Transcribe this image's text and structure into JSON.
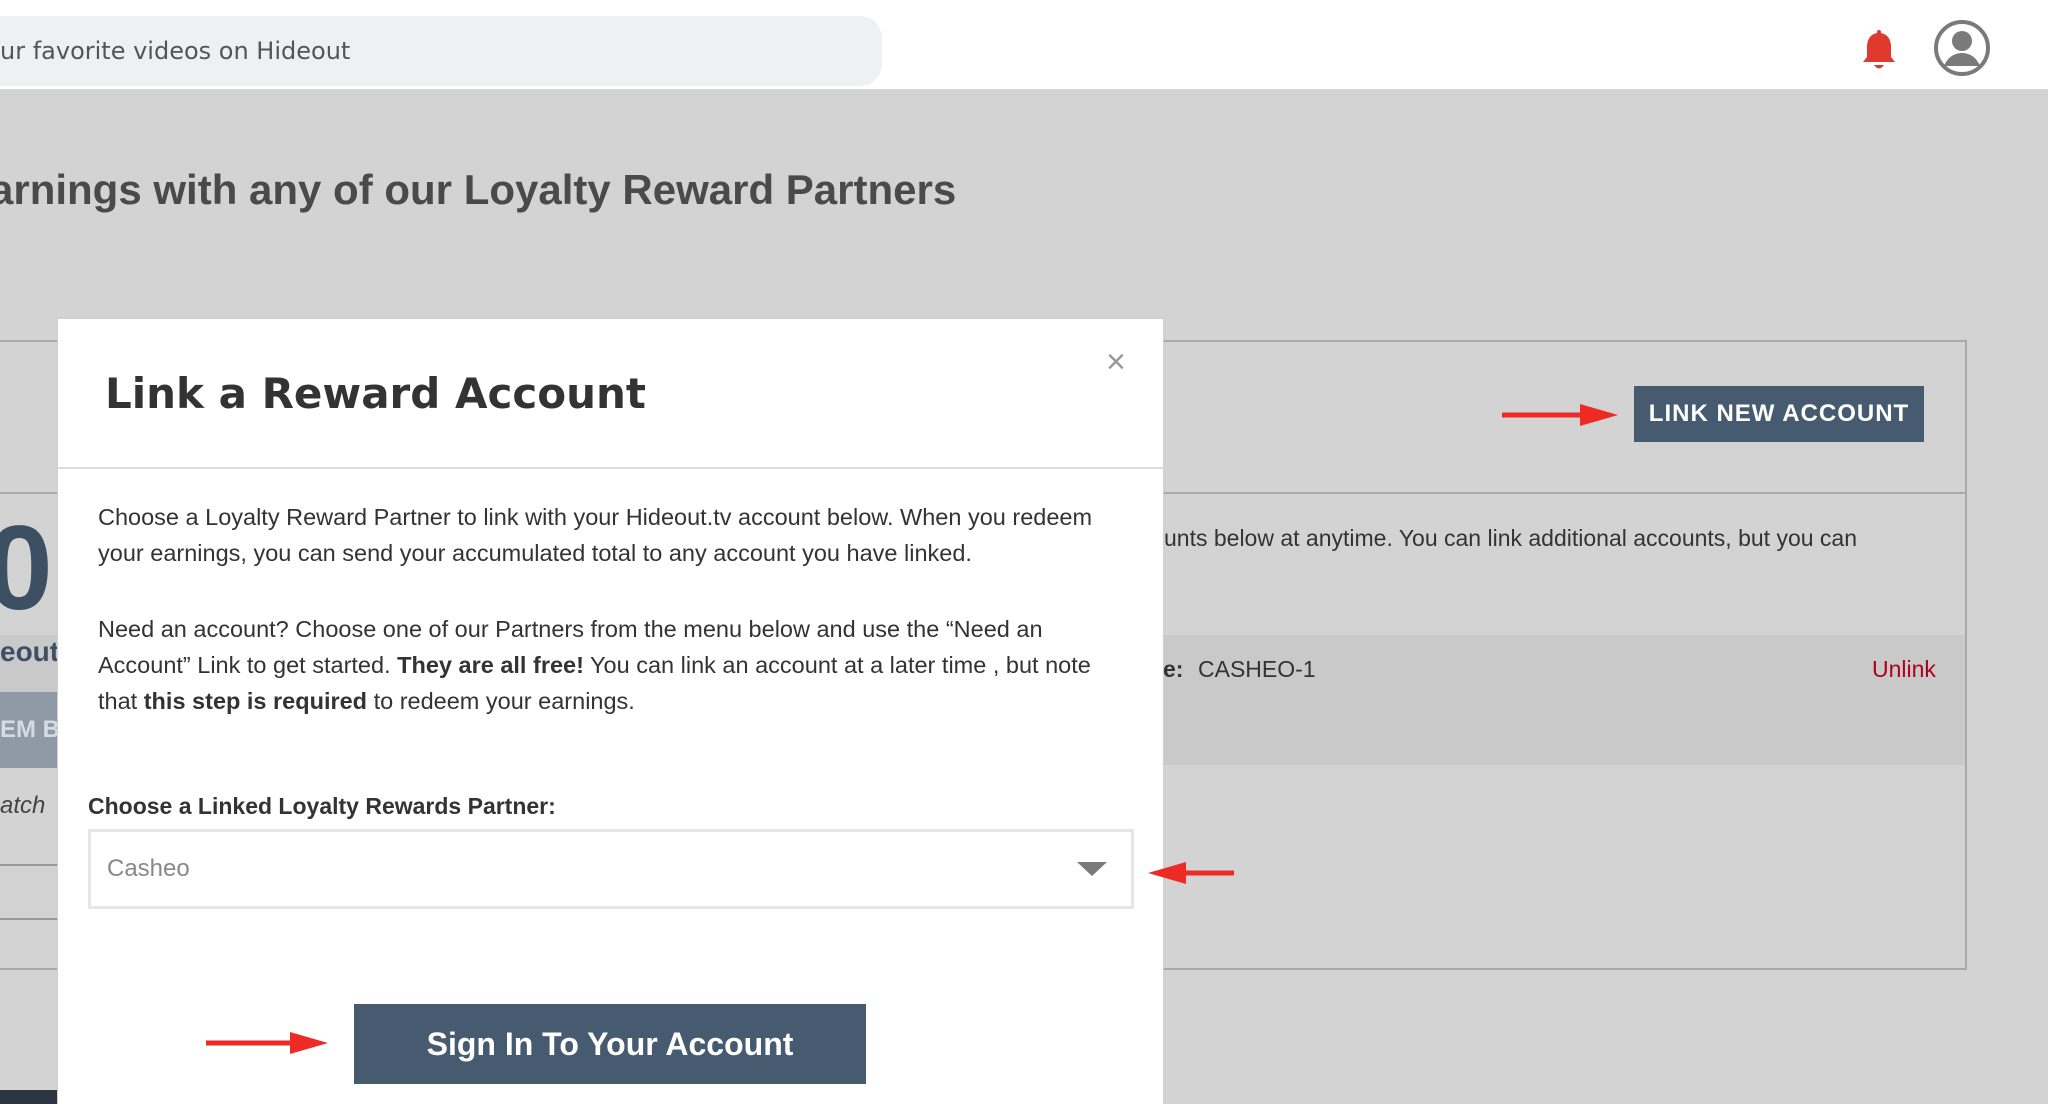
{
  "header": {
    "search_placeholder": "ur favorite videos on Hideout",
    "icons": [
      "bell-icon",
      "user-avatar-icon"
    ],
    "bell_color": "#e03a2e"
  },
  "background_page": {
    "title": "arnings with any of our Loyalty Reward Partners",
    "link_new_account_label": "LINK NEW ACCOUNT",
    "description_partial": "unts below at anytime. You can link additional accounts, but you can",
    "account_name_label": "e:",
    "account_name_value": "CASHEO-1",
    "unlink_label": "Unlink",
    "balance_partial": "0.",
    "balance_caption_partial": "eout",
    "redeem_button_partial": "EM B",
    "watch_text_partial": "atch"
  },
  "modal": {
    "title": "Link a Reward Account",
    "close_symbol": "×",
    "paragraph1": "Choose a Loyalty Reward Partner to link with your Hideout.tv account below. When you redeem your earnings, you can send your accumulated total to any account you have linked.",
    "paragraph2": {
      "part1": "Need an account? Choose one of our Partners from the menu below and use the “Need an Account” Link to get started. ",
      "bold1": "They are all free!",
      "part2": " You can link an account at a later time , but note that ",
      "bold2": "this step is required",
      "part3": " to redeem your earnings."
    },
    "field_label": "Choose a Linked Loyalty Rewards Partner:",
    "selected_partner": "Casheo",
    "sign_in_label": "Sign In To Your Account"
  },
  "colors": {
    "accent_button": "#475b70",
    "annotation_arrow": "#ee2a24",
    "unlink": "#b0001e",
    "overlay": "#d3d3d3"
  }
}
